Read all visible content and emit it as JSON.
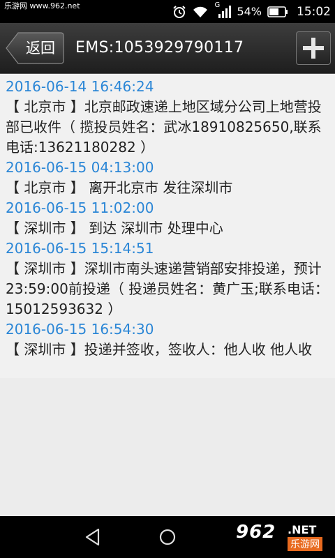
{
  "status_bar": {
    "watermark": "乐游网 www.962.net",
    "battery_pct": "54%",
    "time": "15:02",
    "signal_label": "G",
    "icons": [
      "alarm-icon",
      "wifi-icon",
      "signal-icon",
      "battery-icon"
    ]
  },
  "title_bar": {
    "back_label": "返回",
    "title": "EMS:1053929790117",
    "add_icon": "plus-icon"
  },
  "tracking": [
    {
      "time": "2016-06-14 16:46:24",
      "desc": "【 北京市 】北京邮政速递上地区域分公司上地营投部已收件（ 揽投员姓名：武冰18910825650,联系电话:13621180282 ）"
    },
    {
      "time": "2016-06-15 04:13:00",
      "desc": "【 北京市 】 离开北京市 发往深圳市"
    },
    {
      "time": "2016-06-15 11:02:00",
      "desc": "【 深圳市 】 到达 深圳市 处理中心"
    },
    {
      "time": "2016-06-15 15:14:51",
      "desc": "【 深圳市 】深圳市南头速递营销部安排投递，预计23:59:00前投递（ 投递员姓名：黄广玉;联系电话：15012593632 ）"
    },
    {
      "time": "2016-06-15 16:54:30",
      "desc": "【 深圳市 】投递并签收，签收人：他人收 他人收"
    }
  ],
  "nav_bar": {
    "icons": [
      "back-triangle-icon",
      "home-circle-icon"
    ],
    "watermark_num": "962",
    "watermark_net": ".NET",
    "watermark_cn": "乐游网"
  },
  "colors": {
    "time_blue": "#2a86d6",
    "title_bar": "#2b2b2b",
    "content_bg": "#f1f1f1"
  }
}
